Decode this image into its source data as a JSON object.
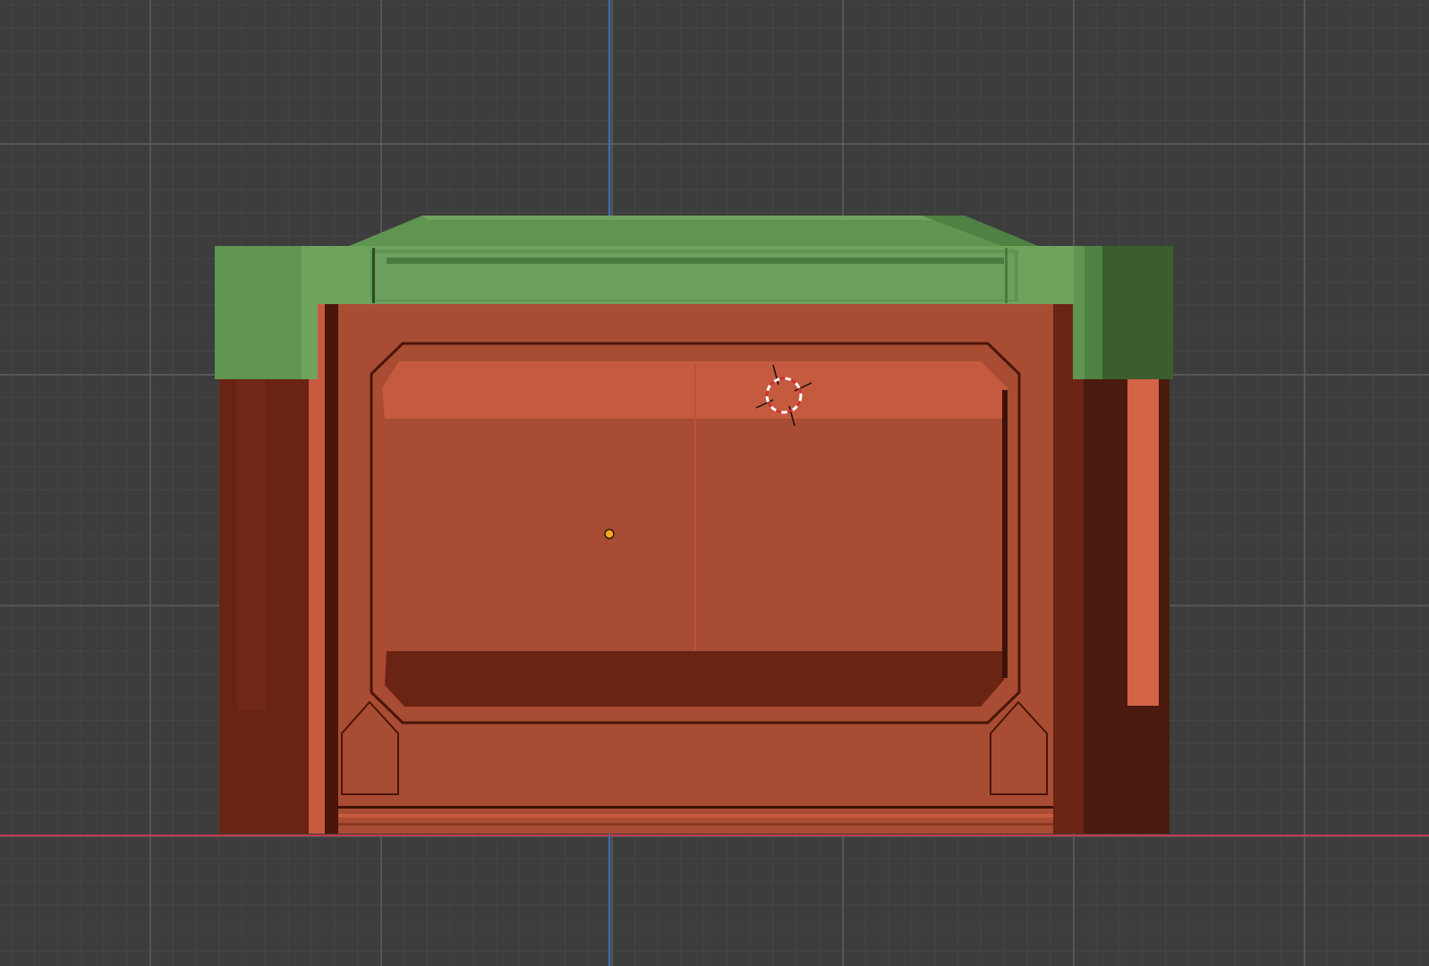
{
  "viewport": {
    "view": "front-orthographic",
    "background_color": "#3d3d3d",
    "grid": true,
    "axis_colors": {
      "x_axis": "#c4394d",
      "z_axis": "#3f6fb8"
    }
  },
  "object": {
    "type": "mesh",
    "state": "selected-origin-shown",
    "materials": {
      "lid": "#5f9550",
      "body": "#a94c34",
      "body_dark": "#6a2414",
      "body_light": "#c85a40"
    }
  },
  "widgets": {
    "object_origin": {
      "icon": "origin-dot-icon",
      "color": "#f5a623"
    },
    "cursor_3d": {
      "icon": "3d-cursor-icon"
    }
  }
}
